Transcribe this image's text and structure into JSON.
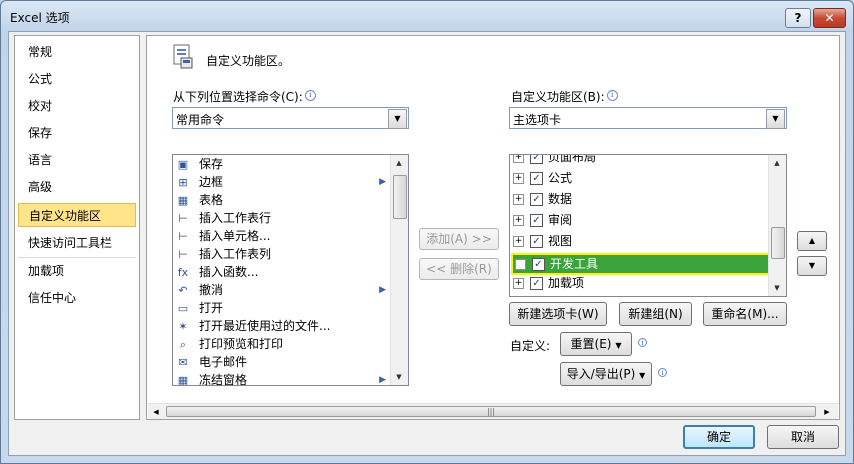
{
  "window": {
    "title": "Excel 选项",
    "help_label": "?",
    "close_label": "✕"
  },
  "nav": {
    "items": [
      {
        "label": "常规"
      },
      {
        "label": "公式"
      },
      {
        "label": "校对"
      },
      {
        "label": "保存"
      },
      {
        "label": "语言"
      },
      {
        "label": "高级"
      },
      {
        "label": "自定义功能区",
        "selected": true
      },
      {
        "label": "快速访问工具栏"
      },
      {
        "label": "加载项"
      },
      {
        "label": "信任中心"
      }
    ]
  },
  "main": {
    "heading": "自定义功能区。",
    "left_label": "从下列位置选择命令(C):",
    "left_combo_value": "常用命令",
    "right_label": "自定义功能区(B):",
    "right_combo_value": "主选项卡",
    "commands": [
      {
        "label": "保存",
        "icon": "save-icon",
        "glyph": "▣"
      },
      {
        "label": "边框",
        "icon": "border-icon",
        "glyph": "⊞",
        "submenu": true
      },
      {
        "label": "表格",
        "icon": "table-icon",
        "glyph": "▦"
      },
      {
        "label": "插入工作表行",
        "icon": "insert-row-icon",
        "glyph": "⊢"
      },
      {
        "label": "插入单元格...",
        "icon": "insert-cell-icon",
        "glyph": "⊢"
      },
      {
        "label": "插入工作表列",
        "icon": "insert-column-icon",
        "glyph": "⊢"
      },
      {
        "label": "插入函数...",
        "icon": "function-icon",
        "glyph": "fx"
      },
      {
        "label": "撤消",
        "icon": "undo-icon",
        "glyph": "↶",
        "submenu": true
      },
      {
        "label": "打开",
        "icon": "open-folder-icon",
        "glyph": "▭"
      },
      {
        "label": "打开最近使用过的文件...",
        "icon": "recent-file-icon",
        "glyph": "✶"
      },
      {
        "label": "打印预览和打印",
        "icon": "print-preview-icon",
        "glyph": "⌕"
      },
      {
        "label": "电子邮件",
        "icon": "email-icon",
        "glyph": "✉"
      },
      {
        "label": "冻结窗格",
        "icon": "freeze-panes-icon",
        "glyph": "▦",
        "submenu": true
      }
    ],
    "add_button": "添加(A) >>",
    "remove_button": "<< 删除(R)",
    "tabs": [
      {
        "label": "页面布局",
        "checked": true
      },
      {
        "label": "公式",
        "checked": true
      },
      {
        "label": "数据",
        "checked": true
      },
      {
        "label": "审阅",
        "checked": true
      },
      {
        "label": "视图",
        "checked": true
      },
      {
        "label": "开发工具",
        "checked": true,
        "highlighted": true
      },
      {
        "label": "加载项",
        "checked": true
      }
    ],
    "new_tab_button": "新建选项卡(W)",
    "new_group_button": "新建组(N)",
    "rename_button": "重命名(M)...",
    "customize_label": "自定义:",
    "reset_button": "重置(E)",
    "import_export_button": "导入/导出(P)"
  },
  "footer": {
    "ok_button": "确定",
    "cancel_button": "取消"
  },
  "colors": {
    "highlight_fill": "#3aa33a",
    "highlight_border": "#fff700",
    "nav_selected": "#ffe48a"
  }
}
